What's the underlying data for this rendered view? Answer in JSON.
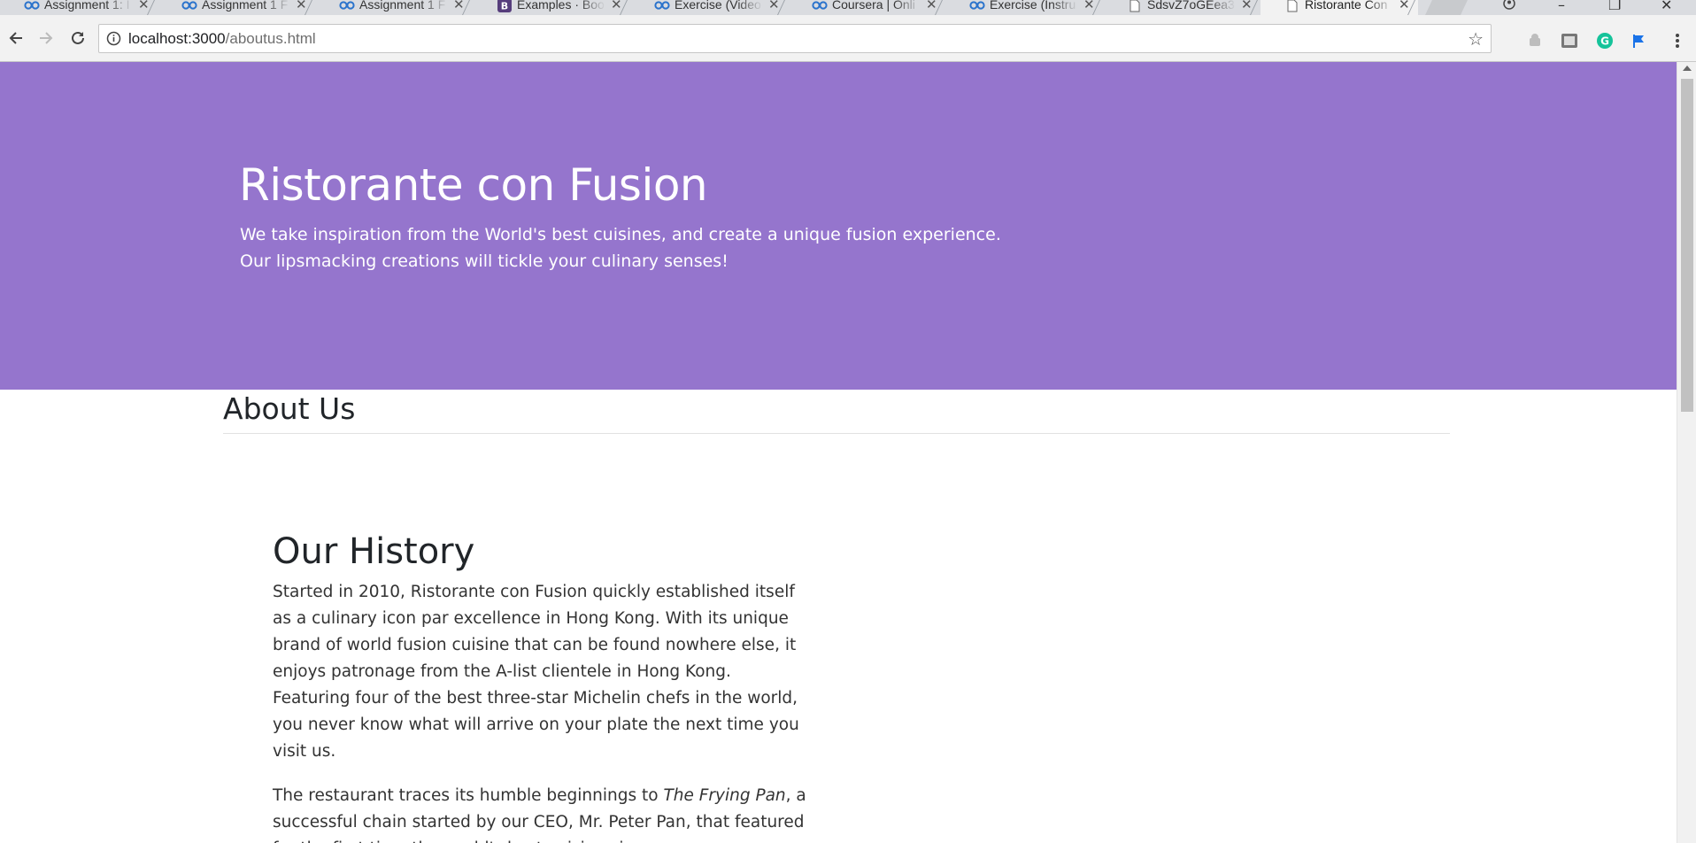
{
  "browser": {
    "tabs": [
      {
        "title": "Assignment 1: I",
        "favicon": "coursera-icon"
      },
      {
        "title": "Assignment 1 F",
        "favicon": "coursera-icon"
      },
      {
        "title": "Assignment 1 F",
        "favicon": "coursera-icon"
      },
      {
        "title": "Examples · Boo",
        "favicon": "bootstrap-icon"
      },
      {
        "title": "Exercise (Video",
        "favicon": "coursera-icon"
      },
      {
        "title": "Coursera | Onli",
        "favicon": "coursera-icon"
      },
      {
        "title": "Exercise (Instru",
        "favicon": "coursera-icon"
      },
      {
        "title": "SdsvZ7oGEea3",
        "favicon": "document-icon"
      },
      {
        "title": "Ristorante Con",
        "favicon": "document-icon",
        "active": true
      }
    ],
    "url_host": "localhost:3000",
    "url_path": "/aboutus.html",
    "colors": {
      "tabstrip": "#dadce0",
      "toolbar": "#f2f2f2"
    }
  },
  "page": {
    "jumbotron": {
      "title": "Ristorante con Fusion",
      "tagline": "We take inspiration from the World's best cuisines, and create a unique fusion experience. Our lipsmacking creations will tickle your culinary senses!",
      "background": "#9575cd"
    },
    "section_heading": "About Us",
    "history": {
      "heading": "Our History",
      "paragraph1": "Started in 2010, Ristorante con Fusion quickly established itself as a culinary icon par excellence in Hong Kong. With its unique brand of world fusion cuisine that can be found nowhere else, it enjoys patronage from the A-list clientele in Hong Kong. Featuring four of the best three-star Michelin chefs in the world, you never know what will arrive on your plate the next time you visit us.",
      "paragraph2_before": "The restaurant traces its humble beginnings to ",
      "paragraph2_em": "The Frying Pan",
      "paragraph2_after": ", a successful chain started by our CEO, Mr. Peter Pan, that featured for the first time the world's best cuisines in a pan."
    }
  }
}
